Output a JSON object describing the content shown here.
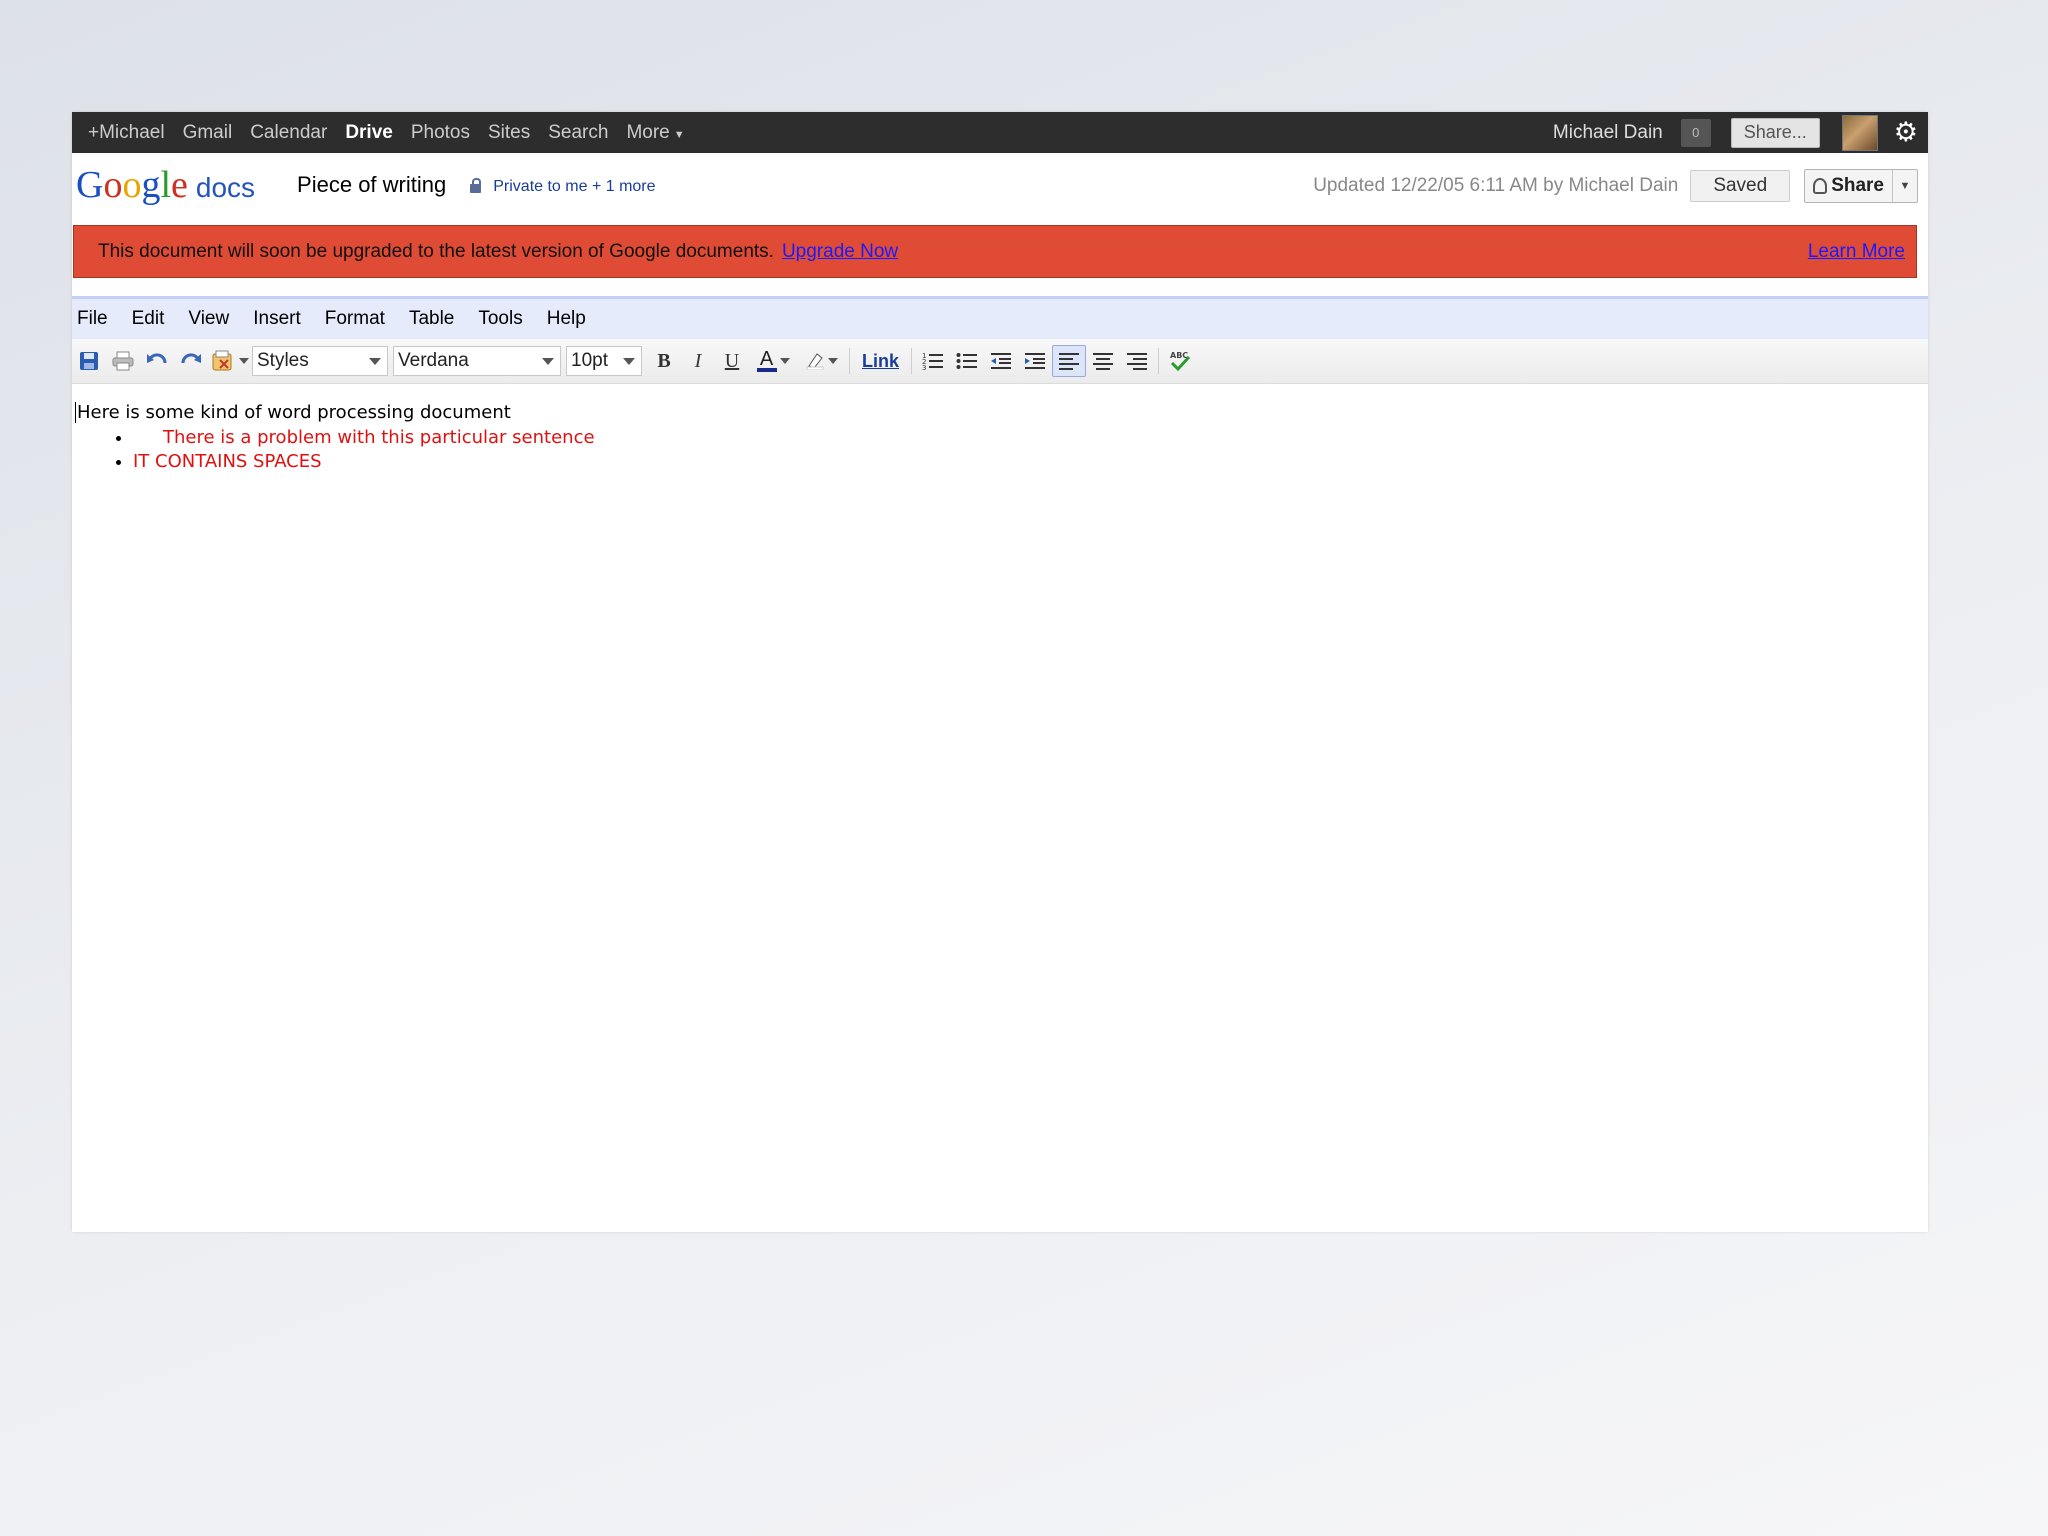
{
  "gbar": {
    "nav": [
      "+Michael",
      "Gmail",
      "Calendar",
      "Drive",
      "Photos",
      "Sites",
      "Search",
      "More"
    ],
    "active": "Drive",
    "user_name": "Michael Dain",
    "notification_count": "0",
    "share_label": "Share..."
  },
  "header": {
    "logo_google": "Google",
    "logo_docs": "docs",
    "doc_title": "Piece of writing",
    "privacy": "Private to me + 1 more",
    "updated": "Updated 12/22/05 6:11 AM by Michael Dain",
    "saved_label": "Saved",
    "share_label": "Share"
  },
  "banner": {
    "message": "This document will soon be upgraded to the latest version of Google documents.",
    "upgrade_link": "Upgrade Now",
    "learn_link": "Learn More",
    "color": "#e04b35"
  },
  "menu": [
    "File",
    "Edit",
    "View",
    "Insert",
    "Format",
    "Table",
    "Tools",
    "Help"
  ],
  "toolbar": {
    "styles": "Styles",
    "font": "Verdana",
    "size": "10pt",
    "link_label": "Link",
    "bold": "B",
    "italic": "I",
    "underline": "U",
    "spell_label": "ABC"
  },
  "document": {
    "line1": "Here is some kind of word processing document",
    "bullets": [
      "There is a problem with this particular sentence",
      "IT CONTAINS SPACES"
    ],
    "text_color": "#e01010"
  }
}
